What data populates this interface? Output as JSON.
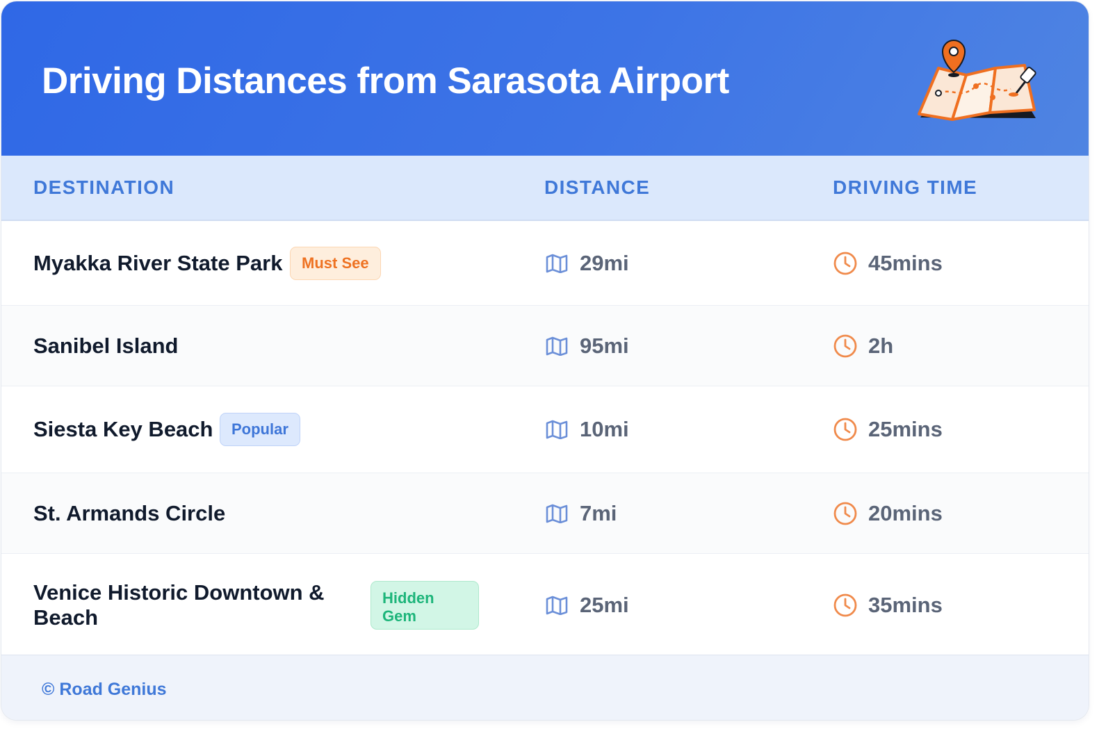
{
  "header": {
    "title": "Driving Distances from Sarasota Airport",
    "illustration": "folded-map-with-location-pin-icon",
    "colors": {
      "gradient_start": "#2f68e6",
      "gradient_end": "#4f84e2",
      "map_accent": "#ef6f20"
    }
  },
  "table": {
    "columns": [
      "DESTINATION",
      "DISTANCE",
      "DRIVING TIME"
    ],
    "distance_icon": "map-icon",
    "time_icon": "clock-icon",
    "rows": [
      {
        "destination": "Myakka River State Park",
        "badge": "Must See",
        "badge_color": "#ee7222",
        "distance": "29mi",
        "time": "45mins"
      },
      {
        "destination": "Sanibel Island",
        "badge": "",
        "distance": "95mi",
        "time": "2h"
      },
      {
        "destination": "Siesta Key Beach",
        "badge": "Popular",
        "badge_color": "#3e76d8",
        "distance": "10mi",
        "time": "25mins"
      },
      {
        "destination": "St. Armands Circle",
        "badge": "",
        "distance": "7mi",
        "time": "20mins"
      },
      {
        "destination": "Venice Historic Downtown & Beach",
        "badge": "Hidden Gem",
        "badge_color": "#1db57a",
        "distance": "25mi",
        "time": "35mins"
      }
    ]
  },
  "footer": {
    "credit": "© Road Genius"
  }
}
